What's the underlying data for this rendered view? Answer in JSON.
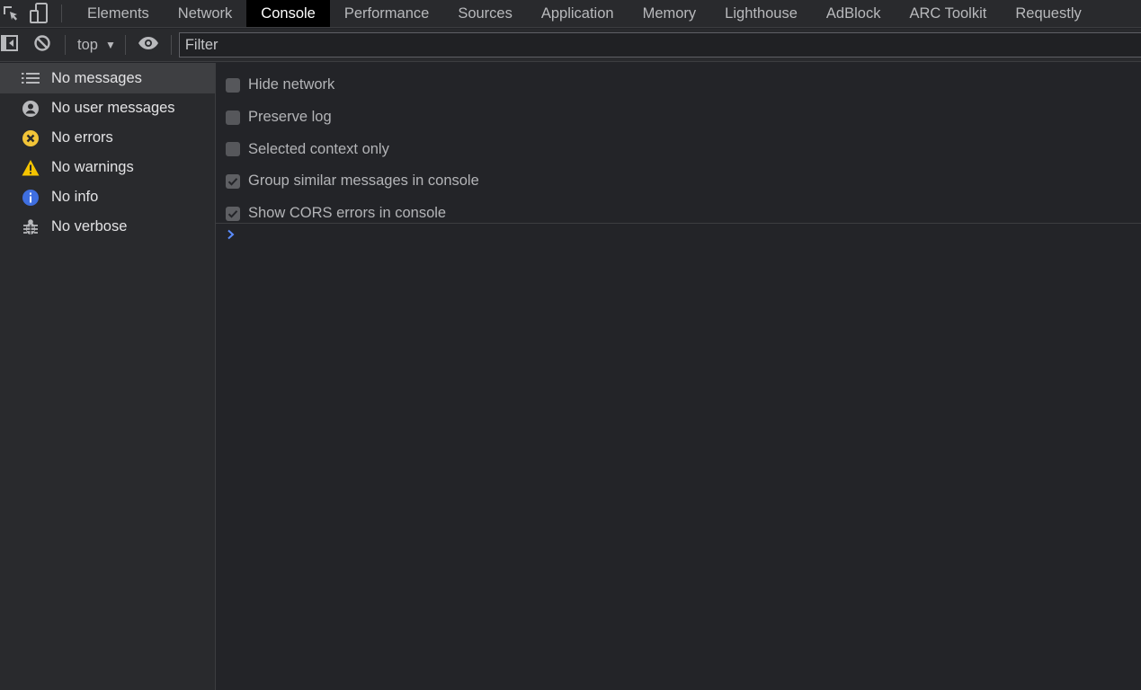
{
  "tabs": [
    {
      "label": "Elements",
      "active": false
    },
    {
      "label": "Network",
      "active": false
    },
    {
      "label": "Console",
      "active": true
    },
    {
      "label": "Performance",
      "active": false
    },
    {
      "label": "Sources",
      "active": false
    },
    {
      "label": "Application",
      "active": false
    },
    {
      "label": "Memory",
      "active": false
    },
    {
      "label": "Lighthouse",
      "active": false
    },
    {
      "label": "AdBlock",
      "active": false
    },
    {
      "label": "ARC Toolkit",
      "active": false
    },
    {
      "label": "Requestly",
      "active": false
    }
  ],
  "toolbar": {
    "context_label": "top",
    "filter_placeholder": "Filter"
  },
  "sidebar": {
    "items": [
      {
        "label": "No messages",
        "icon": "list-icon",
        "selected": true
      },
      {
        "label": "No user messages",
        "icon": "user-icon",
        "selected": false
      },
      {
        "label": "No errors",
        "icon": "error-icon",
        "selected": false
      },
      {
        "label": "No warnings",
        "icon": "warning-icon",
        "selected": false
      },
      {
        "label": "No info",
        "icon": "info-icon",
        "selected": false
      },
      {
        "label": "No verbose",
        "icon": "bug-icon",
        "selected": false
      }
    ]
  },
  "settings": [
    {
      "label": "Hide network",
      "checked": false
    },
    {
      "label": "Preserve log",
      "checked": false
    },
    {
      "label": "Selected context only",
      "checked": false
    },
    {
      "label": "Group similar messages in console",
      "checked": true
    },
    {
      "label": "Show CORS errors in console",
      "checked": true
    }
  ],
  "colors": {
    "error": "#f2c438",
    "warning": "#f5c400",
    "info": "#3f6fe0",
    "prompt": "#5b8cff"
  }
}
